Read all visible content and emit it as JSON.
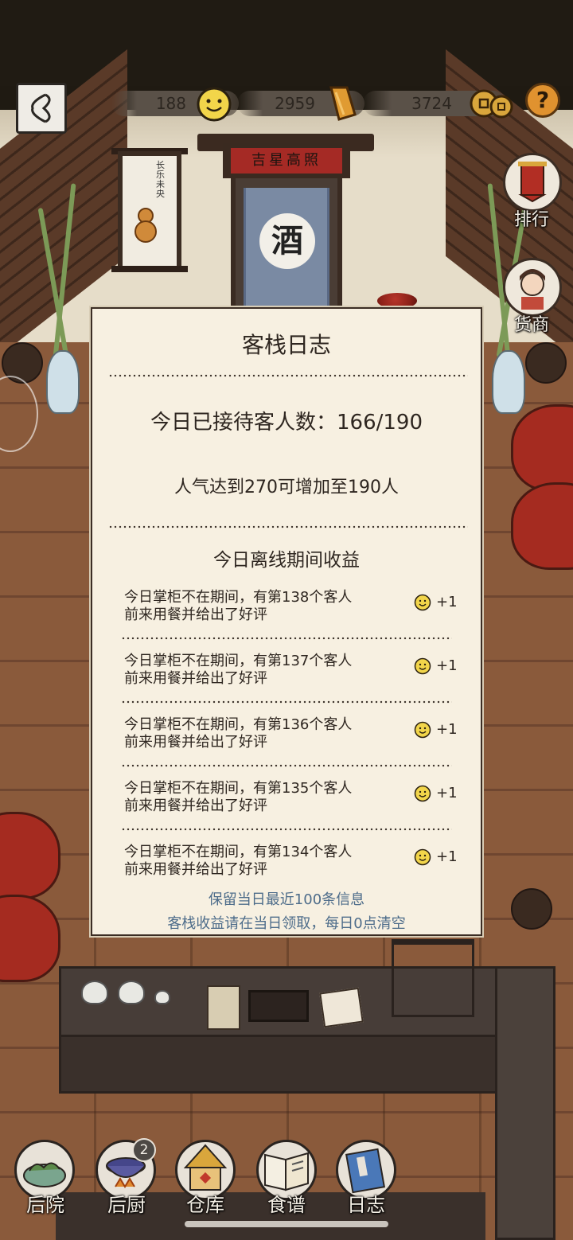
{
  "hud": {
    "resources": [
      {
        "value": "188",
        "icon": "smiley-face-icon",
        "color": "#f2d54a"
      },
      {
        "value": "2959",
        "icon": "gold-ingot-icon",
        "color": "#e09b32"
      },
      {
        "value": "3724",
        "icon": "copper-coins-icon",
        "color": "#d9a63c"
      }
    ],
    "help_label": "?",
    "side_buttons": [
      {
        "label": "排行",
        "icon": "ranking-banner-icon"
      },
      {
        "label": "货商",
        "icon": "merchant-avatar-icon"
      }
    ]
  },
  "scene": {
    "shop_sign": "吉星高照",
    "door_badge": "酒",
    "painting_text": "长乐未央"
  },
  "dialog": {
    "title": "客栈日志",
    "guest_count": "今日已接待客人数：166/190",
    "popularity_hint": "人气达到270可增加至190人",
    "offline_section_title": "今日离线期间收益",
    "entries": [
      {
        "line1": "今日掌柜不在期间，有第138个客人",
        "line2": "前来用餐并给出了好评",
        "reward": "+1"
      },
      {
        "line1": "今日掌柜不在期间，有第137个客人",
        "line2": "前来用餐并给出了好评",
        "reward": "+1"
      },
      {
        "line1": "今日掌柜不在期间，有第136个客人",
        "line2": "前来用餐并给出了好评",
        "reward": "+1"
      },
      {
        "line1": "今日掌柜不在期间，有第135个客人",
        "line2": "前来用餐并给出了好评",
        "reward": "+1"
      },
      {
        "line1": "今日掌柜不在期间，有第134个客人",
        "line2": "前来用餐并给出了好评",
        "reward": "+1"
      }
    ],
    "footnote_1": "保留当日最近100条信息",
    "footnote_2": "客栈收益请在当日领取，每日0点清空"
  },
  "bottom_nav": [
    {
      "label": "后院",
      "icon": "backyard-icon"
    },
    {
      "label": "后厨",
      "icon": "kitchen-wok-icon",
      "badge": "2"
    },
    {
      "label": "仓库",
      "icon": "warehouse-hut-icon"
    },
    {
      "label": "食谱",
      "icon": "recipe-book-icon"
    },
    {
      "label": "日志",
      "icon": "journal-book-icon"
    }
  ],
  "colors": {
    "dialog_bg": "#f7f0e1",
    "footnote": "#4d6c8a",
    "wood_floor": "#8a5a3b",
    "wine_jar": "#a52b20"
  }
}
